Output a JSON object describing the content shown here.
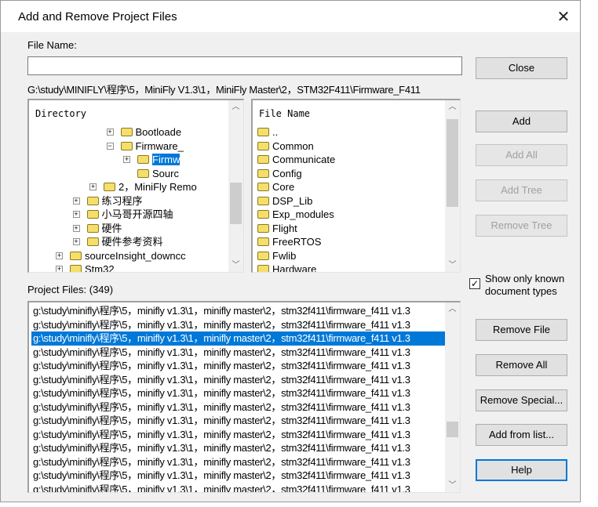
{
  "window": {
    "title": "Add and Remove Project Files",
    "close_icon": "close-x"
  },
  "file_name": {
    "label": "File Name:",
    "value": ""
  },
  "current_path": "G:\\study\\MINIFLY\\程序\\5，MiniFly V1.3\\1，MiniFly Master\\2，STM32F411\\Firmware_F411",
  "directory": {
    "header": "Directory",
    "items": [
      {
        "label": "Bootloade",
        "level": 5,
        "expander": "plus"
      },
      {
        "label": "Firmware_",
        "level": 5,
        "expander": "minus"
      },
      {
        "label": "Firmw",
        "level": 6,
        "expander": "plus",
        "selected": true
      },
      {
        "label": "Sourc",
        "level": 6,
        "expander": "none"
      },
      {
        "label": "2，MiniFly Remo",
        "level": 4,
        "expander": "plus"
      },
      {
        "label": "练习程序",
        "level": 3,
        "expander": "plus"
      },
      {
        "label": "小马哥开源四轴",
        "level": 3,
        "expander": "plus"
      },
      {
        "label": "硬件",
        "level": 3,
        "expander": "plus"
      },
      {
        "label": "硬件参考资料",
        "level": 3,
        "expander": "plus"
      },
      {
        "label": "sourceInsight_downcc",
        "level": 2,
        "expander": "plus"
      },
      {
        "label": "Stm32",
        "level": 2,
        "expander": "plus"
      }
    ]
  },
  "files": {
    "header": "File Name",
    "items": [
      "..",
      "Common",
      "Communicate",
      "Config",
      "Core",
      "DSP_Lib",
      "Exp_modules",
      "Flight",
      "FreeRTOS",
      "Fwlib",
      "Hardware"
    ]
  },
  "project_files": {
    "label": "Project Files: (349)",
    "selected_index": 2,
    "rows": [
      "g:\\study\\minifly\\程序\\5，minifly v1.3\\1，minifly master\\2，stm32f411\\firmware_f411 v1.3",
      "g:\\study\\minifly\\程序\\5，minifly v1.3\\1，minifly master\\2，stm32f411\\firmware_f411 v1.3",
      "g:\\study\\minifly\\程序\\5，minifly v1.3\\1，minifly master\\2，stm32f411\\firmware_f411 v1.3",
      "g:\\study\\minifly\\程序\\5，minifly v1.3\\1，minifly master\\2，stm32f411\\firmware_f411 v1.3",
      "g:\\study\\minifly\\程序\\5，minifly v1.3\\1，minifly master\\2，stm32f411\\firmware_f411 v1.3",
      "g:\\study\\minifly\\程序\\5，minifly v1.3\\1，minifly master\\2，stm32f411\\firmware_f411 v1.3",
      "g:\\study\\minifly\\程序\\5，minifly v1.3\\1，minifly master\\2，stm32f411\\firmware_f411 v1.3",
      "g:\\study\\minifly\\程序\\5，minifly v1.3\\1，minifly master\\2，stm32f411\\firmware_f411 v1.3",
      "g:\\study\\minifly\\程序\\5，minifly v1.3\\1，minifly master\\2，stm32f411\\firmware_f411 v1.3",
      "g:\\study\\minifly\\程序\\5，minifly v1.3\\1，minifly master\\2，stm32f411\\firmware_f411 v1.3",
      "g:\\study\\minifly\\程序\\5，minifly v1.3\\1，minifly master\\2，stm32f411\\firmware_f411 v1.3",
      "g:\\study\\minifly\\程序\\5，minifly v1.3\\1，minifly master\\2，stm32f411\\firmware_f411 v1.3",
      "g:\\study\\minifly\\程序\\5，minifly v1.3\\1，minifly master\\2，stm32f411\\firmware_f411 v1.3",
      "g:\\study\\minifly\\程序\\5，minifly v1.3\\1，minifly master\\2，stm32f411\\firmware_f411 v1.3"
    ]
  },
  "buttons": {
    "close": "Close",
    "add": "Add",
    "add_all": "Add All",
    "add_tree": "Add Tree",
    "remove_tree": "Remove Tree",
    "remove_file": "Remove File",
    "remove_all": "Remove All",
    "remove_special": "Remove Special...",
    "add_from_list": "Add from list...",
    "help": "Help"
  },
  "show_known": {
    "label": "Show only known document types",
    "checked": true
  },
  "colors": {
    "selection": "#0078d7",
    "folder": "#f5df6a"
  }
}
